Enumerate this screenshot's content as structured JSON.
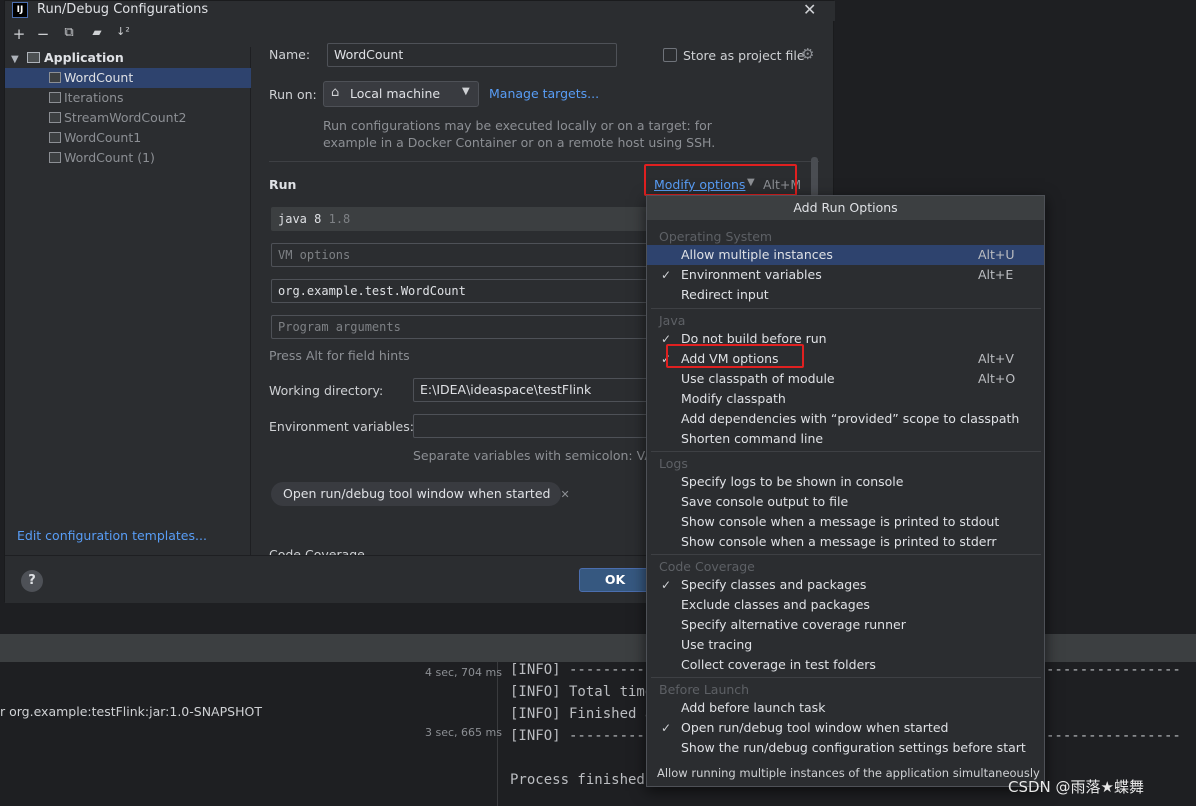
{
  "dialog": {
    "title": "Run/Debug Configurations",
    "app_icon_text": "IJ",
    "close_glyph": "✕"
  },
  "tree_toolbar": [
    "+",
    "−",
    "⧉",
    "▰",
    "↓²"
  ],
  "tree": {
    "group": "Application",
    "items": [
      "WordCount",
      "Iterations",
      "StreamWordCount2",
      "WordCount1",
      "WordCount (1)"
    ],
    "selected": "WordCount"
  },
  "edit_templates": "Edit configuration templates...",
  "form": {
    "name_label": "Name:",
    "name_value": "WordCount",
    "store_label": "Store as project file",
    "runon_label": "Run on:",
    "runon_value": "Local machine",
    "manage_targets": "Manage targets...",
    "runon_help_1": "Run configurations may be executed locally or on a target: for",
    "runon_help_2": "example in a Docker Container or on a remote host using SSH.",
    "run_section": "Run",
    "modify_options": "Modify options",
    "modify_shortcut": "Alt+M",
    "jdk_value": "java 8",
    "jdk_version": "1.8",
    "vm_placeholder": "VM options",
    "main_class": "org.example.test.WordCount",
    "args_placeholder": "Program arguments",
    "field_hint": "Press Alt for field hints",
    "workdir_label": "Working directory:",
    "workdir_value": "E:\\IDEA\\ideaspace\\testFlink",
    "env_label": "Environment variables:",
    "env_help": "Separate variables with semicolon: VAR=",
    "open_tool_tag": "Open run/debug tool window when started",
    "code_coverage": "Code Coverage"
  },
  "footer": {
    "help": "?",
    "ok": "OK"
  },
  "popup": {
    "title": "Add Run Options",
    "groups": [
      {
        "label": "Operating System",
        "items": [
          {
            "text": "Allow multiple instances",
            "check": "",
            "shortcut": "Alt+U"
          },
          {
            "text": "Environment variables",
            "check": "✓",
            "shortcut": "Alt+E"
          },
          {
            "text": "Redirect input",
            "check": "",
            "shortcut": ""
          }
        ]
      },
      {
        "label": "Java",
        "items": [
          {
            "text": "Do not build before run",
            "check": "✓",
            "shortcut": ""
          },
          {
            "text": "Add VM options",
            "check": "✓",
            "shortcut": "Alt+V"
          },
          {
            "text": "Use classpath of module",
            "check": "",
            "shortcut": "Alt+O"
          },
          {
            "text": "Modify classpath",
            "check": "",
            "shortcut": ""
          },
          {
            "text": "Add dependencies with “provided” scope to classpath",
            "check": "",
            "shortcut": ""
          },
          {
            "text": "Shorten command line",
            "check": "",
            "shortcut": ""
          }
        ]
      },
      {
        "label": "Logs",
        "items": [
          {
            "text": "Specify logs to be shown in console",
            "check": "",
            "shortcut": ""
          },
          {
            "text": "Save console output to file",
            "check": "",
            "shortcut": ""
          },
          {
            "text": "Show console when a message is printed to stdout",
            "check": "",
            "shortcut": ""
          },
          {
            "text": "Show console when a message is printed to stderr",
            "check": "",
            "shortcut": ""
          }
        ]
      },
      {
        "label": "Code Coverage",
        "items": [
          {
            "text": "Specify classes and packages",
            "check": "✓",
            "shortcut": ""
          },
          {
            "text": "Exclude classes and packages",
            "check": "",
            "shortcut": ""
          },
          {
            "text": "Specify alternative coverage runner",
            "check": "",
            "shortcut": ""
          },
          {
            "text": "Use tracing",
            "check": "",
            "shortcut": ""
          },
          {
            "text": "Collect coverage in test folders",
            "check": "",
            "shortcut": ""
          }
        ]
      },
      {
        "label": "Before Launch",
        "items": [
          {
            "text": "Add before launch task",
            "check": "",
            "shortcut": ""
          },
          {
            "text": "Open run/debug tool window when started",
            "check": "✓",
            "shortcut": ""
          },
          {
            "text": "Show the run/debug configuration settings before start",
            "check": "",
            "shortcut": ""
          }
        ]
      }
    ],
    "hint": "Allow running multiple instances of the application simultaneously"
  },
  "background": {
    "dur_1": "4 sec, 704 ms",
    "dur_2": "3 sec, 665 ms",
    "artifact": "r org.example:testFlink:jar:1.0-SNAPSHOT",
    "log_1": "[INFO] ----------",
    "log_2": "[INFO] Total time",
    "log_3": "[INFO] Finished a",
    "log_4": "[INFO] ----------",
    "log_5": "Process finished",
    "right_dashes_1": "----------------",
    "right_dashes_2": "----------------"
  },
  "watermark": "CSDN @雨落★蝶舞",
  "colors": {
    "accent": "#589df6",
    "selection": "#2e436e",
    "highlight_box": "#e02020"
  }
}
